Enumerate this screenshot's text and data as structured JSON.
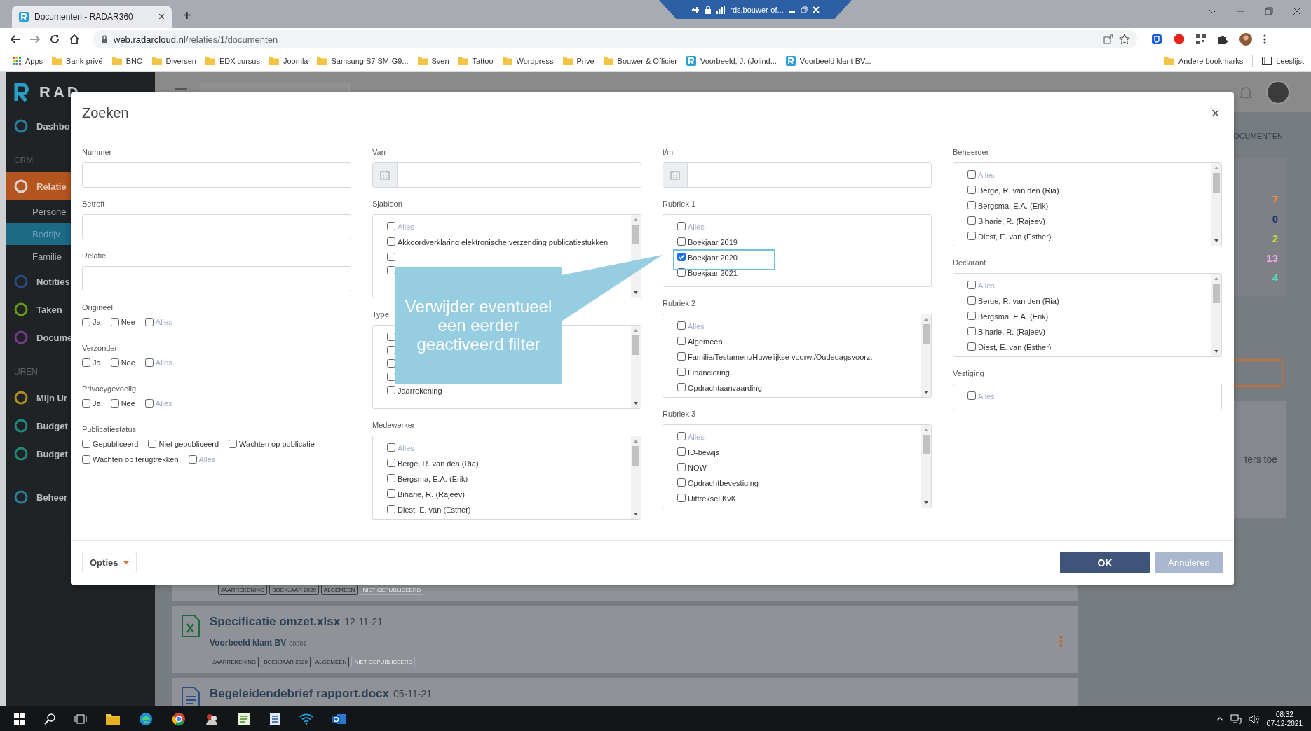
{
  "browser": {
    "tab_title": "Documenten - RADAR360",
    "tab_close": "×",
    "new_tab": "+",
    "remote_host": "rds.bouwer-of...",
    "url_host": "web.radarcloud.nl",
    "url_path": "/relaties/1/documenten",
    "bookmarks": [
      {
        "label": "Apps",
        "kind": "apps"
      },
      {
        "label": "Bank-privé",
        "kind": "folder"
      },
      {
        "label": "BNO",
        "kind": "folder"
      },
      {
        "label": "Diversen",
        "kind": "folder"
      },
      {
        "label": "EDX cursus",
        "kind": "folder"
      },
      {
        "label": "Joomla",
        "kind": "folder"
      },
      {
        "label": "Samsung S7 SM-G9...",
        "kind": "folder"
      },
      {
        "label": "Sven",
        "kind": "folder"
      },
      {
        "label": "Tattoo",
        "kind": "folder"
      },
      {
        "label": "Wordpress",
        "kind": "folder"
      },
      {
        "label": "Prive",
        "kind": "folder"
      },
      {
        "label": "Bouwer & Officier",
        "kind": "folder"
      },
      {
        "label": "Voorbeeld, J. (Jolind...",
        "kind": "site"
      },
      {
        "label": "Voorbeeld klant BV...",
        "kind": "site"
      }
    ],
    "bookmarks_right": [
      {
        "label": "Andere bookmarks",
        "kind": "folder"
      },
      {
        "label": "Leeslijst",
        "kind": "reading"
      }
    ]
  },
  "sidebar": {
    "logo": "RAD",
    "sections": [
      {
        "items": [
          {
            "label": "Dashbo",
            "color": "#2a7fa0",
            "selected": false
          }
        ]
      },
      {
        "heading": "CRM",
        "items": [
          {
            "label": "Relatie",
            "color": "#d7d7d7",
            "selected": true,
            "children": [
              {
                "label": "Persone",
                "selected": false
              },
              {
                "label": "Bedrijv",
                "selected": true
              },
              {
                "label": "Familie",
                "selected": false
              }
            ]
          },
          {
            "label": "Notities",
            "color": "#2a4a80",
            "selected": false
          },
          {
            "label": "Taken",
            "color": "#6a9a1a",
            "selected": false
          },
          {
            "label": "Docume",
            "color": "#7a3a8a",
            "selected": false
          }
        ]
      },
      {
        "heading": "UREN",
        "items": [
          {
            "label": "Mijn Ur",
            "color": "#b0901a",
            "selected": false
          },
          {
            "label": "Budget",
            "color": "#1f8a7a",
            "selected": false
          },
          {
            "label": "Budget",
            "color": "#1f8a7a",
            "selected": false
          }
        ]
      },
      {
        "items": [
          {
            "label": "Beheer",
            "color": "#2a7fa0",
            "selected": false
          }
        ]
      }
    ]
  },
  "right_panel": {
    "breadcrumb": "OCUMENTEN",
    "counts": [
      {
        "value": "7",
        "color": "#ff8a4a"
      },
      {
        "value": "0",
        "color": "#1c3a70"
      },
      {
        "value": "2",
        "color": "#c8dc40"
      },
      {
        "value": "13",
        "color": "#f0a8f4"
      },
      {
        "value": "4",
        "color": "#4fe0c0"
      }
    ],
    "hint": "ters toe"
  },
  "documents": [
    {
      "kind": "tags_only",
      "tags": [
        {
          "label": "JAARREKENING",
          "muted": false
        },
        {
          "label": "BOEKJAAR 2020",
          "muted": false
        },
        {
          "label": "ALGEMEEN",
          "muted": false
        },
        {
          "label": "NIET GEPUBLICEERD",
          "muted": true
        }
      ]
    },
    {
      "kind": "spreadsheet",
      "title": "Specificatie omzet.xlsx",
      "date": "12-11-21",
      "client": "Voorbeeld klant BV",
      "client_number": "00001",
      "tags": [
        {
          "label": "JAARREKENING",
          "muted": false
        },
        {
          "label": "BOEKJAAR 2020",
          "muted": false
        },
        {
          "label": "ALGEMEEN",
          "muted": false
        },
        {
          "label": "NIET GEPUBLICEERD",
          "muted": true
        }
      ]
    },
    {
      "kind": "document",
      "title": "Begeleidendebrief rapport.docx",
      "date": "05-11-21"
    }
  ],
  "modal": {
    "title": "Zoeken",
    "close": "×",
    "columns": [
      {
        "fields": [
          {
            "kind": "text",
            "label": "Nummer"
          },
          {
            "kind": "text",
            "label": "Betreft"
          },
          {
            "kind": "text",
            "label": "Relatie"
          },
          {
            "kind": "checks",
            "label": "Origineel",
            "options": [
              {
                "label": "Ja",
                "kind": "option",
                "checked": false
              },
              {
                "label": "Nee",
                "kind": "option",
                "checked": false
              },
              {
                "label": "Alles",
                "kind": "all",
                "checked": false
              }
            ]
          },
          {
            "kind": "checks",
            "label": "Verzonden",
            "options": [
              {
                "label": "Ja",
                "kind": "option",
                "checked": false
              },
              {
                "label": "Nee",
                "kind": "option",
                "checked": false
              },
              {
                "label": "Alles",
                "kind": "all",
                "checked": false
              }
            ]
          },
          {
            "kind": "checks",
            "label": "Privacygevoelig",
            "options": [
              {
                "label": "Ja",
                "kind": "option",
                "checked": false
              },
              {
                "label": "Nee",
                "kind": "option",
                "checked": false
              },
              {
                "label": "Alles",
                "kind": "all",
                "checked": false
              }
            ]
          },
          {
            "kind": "checks",
            "label": "Publicatiestatus",
            "options": [
              {
                "label": "Gepubliceerd",
                "kind": "option",
                "checked": false
              },
              {
                "label": "Niet gepubliceerd",
                "kind": "option",
                "checked": false
              },
              {
                "label": "Wachten op publicatie",
                "kind": "option",
                "checked": false
              },
              {
                "label": "Wachten op terugtrekken",
                "kind": "option",
                "checked": false
              },
              {
                "label": "Alles",
                "kind": "all",
                "checked": false
              }
            ]
          }
        ]
      },
      {
        "fields": [
          {
            "kind": "date",
            "label": "Van"
          },
          {
            "kind": "list",
            "label": "Sjabloon",
            "scrollbar": true,
            "options": [
              {
                "label": "Alles",
                "kind": "all",
                "checked": false
              },
              {
                "label": "Akkoordverklaring elektronische verzending publicatiestukken",
                "kind": "option",
                "checked": false
              },
              {
                "kind": "option",
                "checked": false
              },
              {
                "kind": "option",
                "checked": false
              }
            ]
          },
          {
            "kind": "list",
            "label": "Type",
            "scrollbar": true,
            "options": [
              {
                "kind": "option",
                "checked": false
              },
              {
                "kind": "option",
                "checked": false
              },
              {
                "kind": "option",
                "checked": false
              },
              {
                "kind": "option",
                "checked": false
              },
              {
                "label": "Jaarrekening",
                "kind": "option",
                "checked": false
              }
            ]
          },
          {
            "kind": "list",
            "label": "Medewerker",
            "scrollbar": true,
            "options": [
              {
                "label": "Alles",
                "kind": "all",
                "checked": false
              },
              {
                "label": "Berge, R. van den (Ria)",
                "kind": "option",
                "checked": false
              },
              {
                "label": "Bergsma, E.A. (Erik)",
                "kind": "option",
                "checked": false
              },
              {
                "label": "Biharie, R. (Rajeev)",
                "kind": "option",
                "checked": false
              },
              {
                "label": "Diest, E. van (Esther)",
                "kind": "option",
                "checked": false
              }
            ]
          }
        ]
      },
      {
        "fields": [
          {
            "kind": "date",
            "label": "t/m"
          },
          {
            "kind": "list",
            "label": "Rubriek 1",
            "scrollbar": false,
            "options": [
              {
                "label": "Alles",
                "kind": "all",
                "checked": false
              },
              {
                "label": "Boekjaar 2019",
                "kind": "option",
                "checked": false
              },
              {
                "label": "Boekjaar 2020",
                "kind": "option",
                "checked": true
              },
              {
                "label": "Boekjaar 2021",
                "kind": "option",
                "checked": false
              }
            ]
          },
          {
            "kind": "list",
            "label": "Rubriek 2",
            "scrollbar": true,
            "options": [
              {
                "label": "Alles",
                "kind": "all",
                "checked": false
              },
              {
                "label": "Algemeen",
                "kind": "option",
                "checked": false
              },
              {
                "label": "Familie/Testament/Huwelijkse voorw./Oudedagsvoorz.",
                "kind": "option",
                "checked": false
              },
              {
                "label": "Financiering",
                "kind": "option",
                "checked": false
              },
              {
                "label": "Opdrachtaanvaarding",
                "kind": "option",
                "checked": false
              }
            ]
          },
          {
            "kind": "list",
            "label": "Rubriek 3",
            "scrollbar": true,
            "options": [
              {
                "label": "Alles",
                "kind": "all",
                "checked": false
              },
              {
                "label": "ID-bewijs",
                "kind": "option",
                "checked": false
              },
              {
                "label": "NOW",
                "kind": "option",
                "checked": false
              },
              {
                "label": "Opdrachtbevestiging",
                "kind": "option",
                "checked": false
              },
              {
                "label": "Uittreksel KvK",
                "kind": "option",
                "checked": false
              }
            ]
          }
        ]
      },
      {
        "fields": [
          {
            "kind": "list",
            "label": "Beheerder",
            "scrollbar": true,
            "options": [
              {
                "label": "Alles",
                "kind": "all",
                "checked": false
              },
              {
                "label": "Berge, R. van den (Ria)",
                "kind": "option",
                "checked": false
              },
              {
                "label": "Bergsma, E.A. (Erik)",
                "kind": "option",
                "checked": false
              },
              {
                "label": "Biharie, R. (Rajeev)",
                "kind": "option",
                "checked": false
              },
              {
                "label": "Diest, E. van (Esther)",
                "kind": "option",
                "checked": false
              }
            ]
          },
          {
            "kind": "list",
            "label": "Declarant",
            "scrollbar": true,
            "options": [
              {
                "label": "Alles",
                "kind": "all",
                "checked": false
              },
              {
                "label": "Berge, R. van den (Ria)",
                "kind": "option",
                "checked": false
              },
              {
                "label": "Bergsma, E.A. (Erik)",
                "kind": "option",
                "checked": false
              },
              {
                "label": "Biharie, R. (Rajeev)",
                "kind": "option",
                "checked": false
              },
              {
                "label": "Diest, E. van (Esther)",
                "kind": "option",
                "checked": false
              }
            ]
          },
          {
            "kind": "list",
            "label": "Vestiging",
            "scrollbar": false,
            "options": [
              {
                "label": "Alles",
                "kind": "all",
                "checked": false
              }
            ]
          }
        ]
      }
    ],
    "callout": "Verwijder eventueel een eerder geactiveerd filter",
    "options_button": "Opties",
    "ok_button": "OK",
    "cancel_button": "Annuleren"
  },
  "taskbar": {
    "time": "08:32",
    "date": "07-12-2021"
  }
}
